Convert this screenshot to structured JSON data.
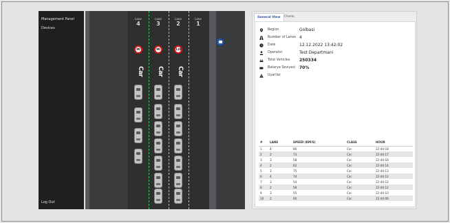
{
  "sidebar": {
    "items": [
      {
        "label": "Management Panel"
      },
      {
        "label": "Devices"
      }
    ],
    "logout_label": "Log Out"
  },
  "road": {
    "lanes": [
      {
        "title": "Lane",
        "number": "4",
        "speed_sign": "90",
        "vehicle_label": "Car"
      },
      {
        "title": "Lane",
        "number": "3",
        "speed_sign": "90",
        "vehicle_label": "Car"
      },
      {
        "title": "Lane",
        "number": "2",
        "speed_sign": "110",
        "vehicle_label": "Car"
      },
      {
        "title": "Lane",
        "number": "1"
      }
    ],
    "camera_icon": "camera-pin-icon"
  },
  "panel": {
    "tabs": [
      {
        "label": "General View",
        "active": true
      },
      {
        "label": "Charts",
        "active": false
      }
    ],
    "info": [
      {
        "icon": "location-pin-icon",
        "label": "Region",
        "value": "Golbasi"
      },
      {
        "icon": "road-icon",
        "label": "Number of Lanes",
        "value": "4"
      },
      {
        "icon": "clock-icon",
        "label": "Date",
        "value": "12.12.2022 13:42:02"
      },
      {
        "icon": "person-icon",
        "label": "Operator",
        "value": "Test Departmani"
      },
      {
        "icon": "car-icon",
        "label": "Total Vehicles",
        "value": "250334"
      },
      {
        "icon": "battery-icon",
        "label": "Batarya Seviyesi",
        "value": "70%"
      },
      {
        "icon": "warning-icon",
        "label": "Uyarilar",
        "value": ""
      }
    ],
    "table": {
      "headers": [
        "#",
        "LANE",
        "SPEED (KM/S)",
        "CLASS",
        "HOUR"
      ],
      "rows": [
        [
          "1",
          "4",
          "86",
          "Car",
          "22:44:18"
        ],
        [
          "2",
          "2",
          "73",
          "Car",
          "22:44:17"
        ],
        [
          "3",
          "3",
          "58",
          "Car",
          "22:44:16"
        ],
        [
          "4",
          "2",
          "62",
          "Car",
          "22:44:14"
        ],
        [
          "5",
          "3",
          "75",
          "Car",
          "22:44:13"
        ],
        [
          "6",
          "4",
          "74",
          "Car",
          "22:44:12"
        ],
        [
          "7",
          "3",
          "54",
          "Car",
          "22:44:12"
        ],
        [
          "8",
          "2",
          "58",
          "Car",
          "22:44:12"
        ],
        [
          "9",
          "3",
          "55",
          "Car",
          "22:44:10"
        ],
        [
          "10",
          "2",
          "60",
          "Car",
          "22:44:06"
        ]
      ]
    }
  }
}
